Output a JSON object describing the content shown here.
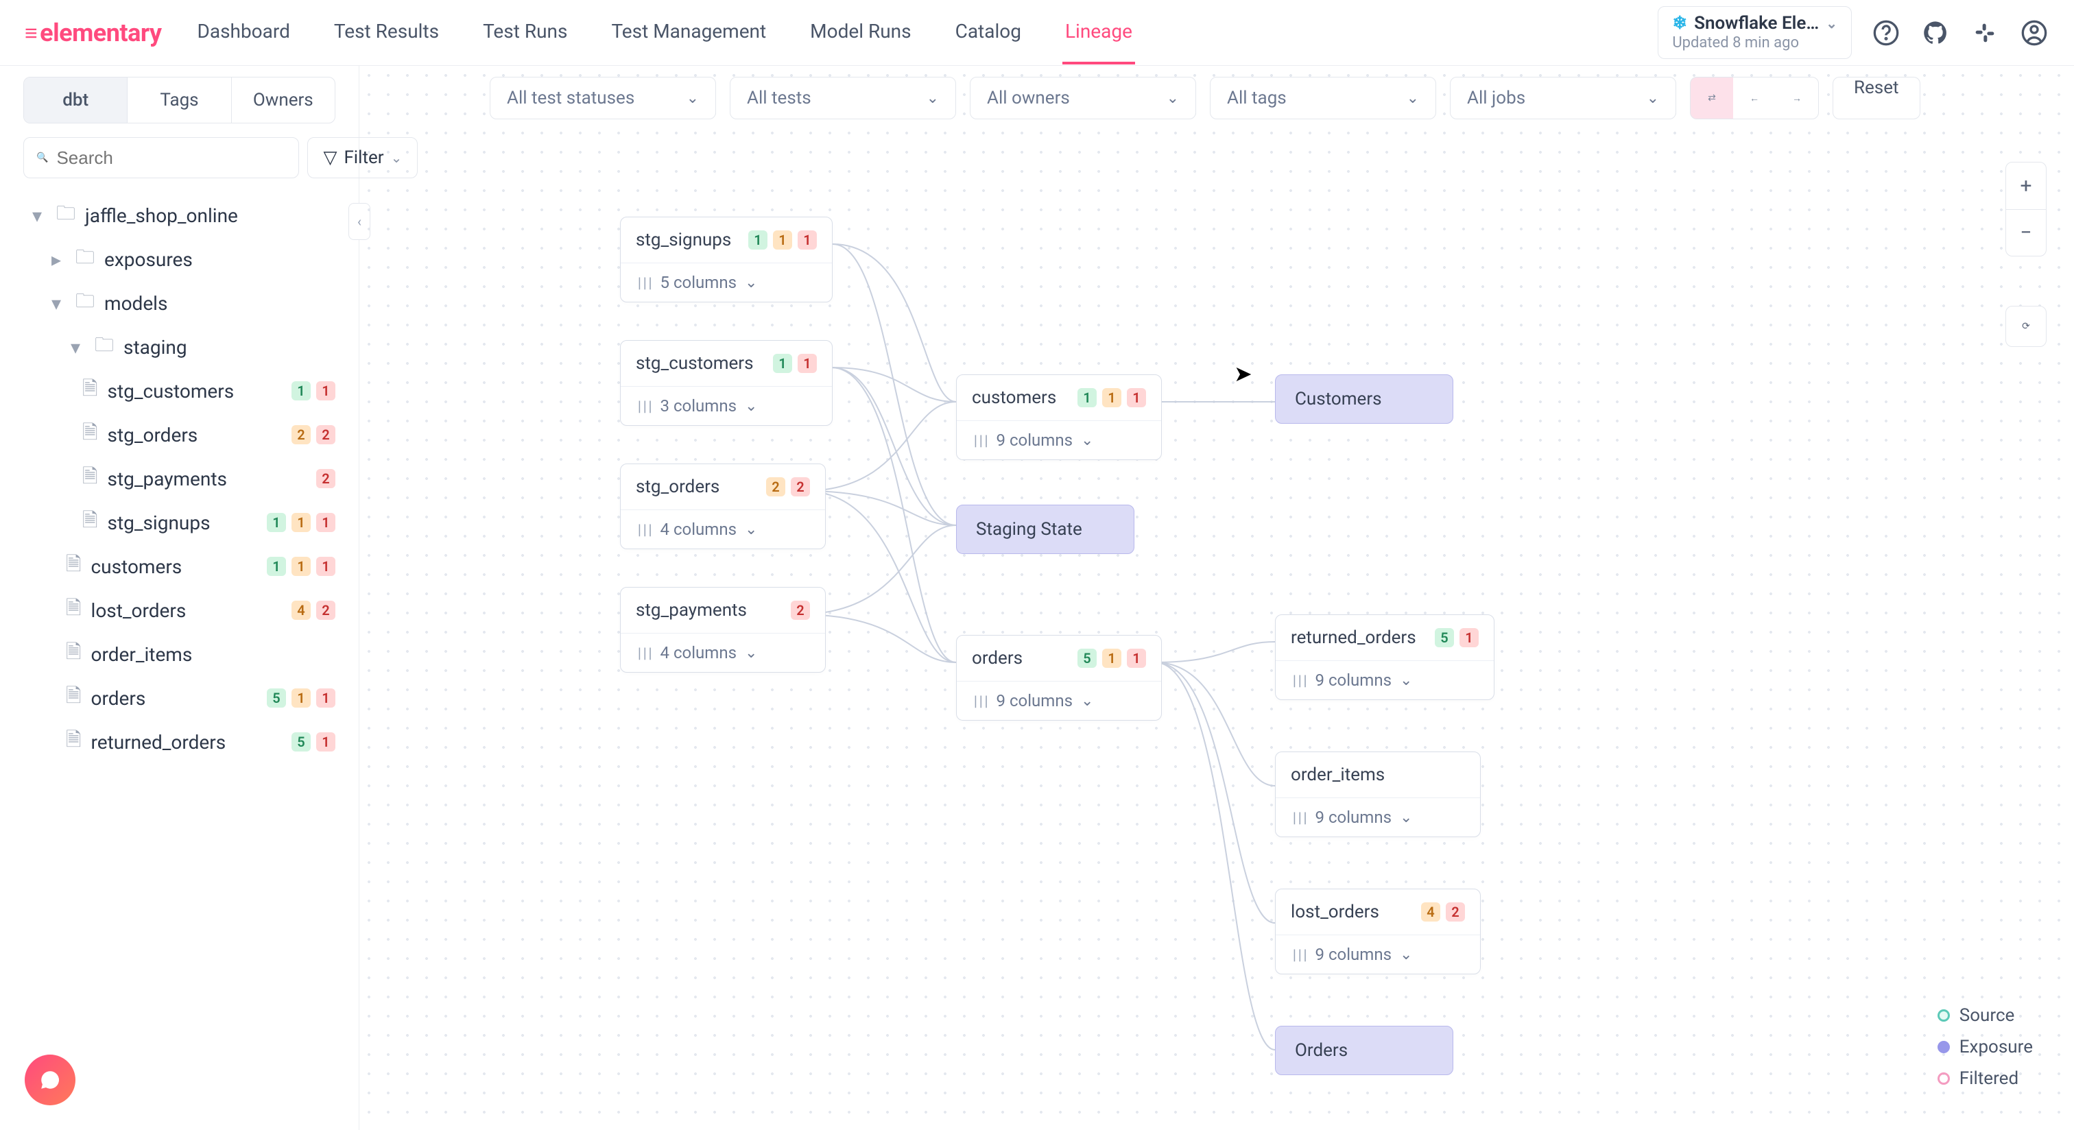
{
  "header": {
    "brand": "elementary",
    "nav": [
      "Dashboard",
      "Test Results",
      "Test Runs",
      "Test Management",
      "Model Runs",
      "Catalog",
      "Lineage"
    ],
    "active_nav": "Lineage",
    "env_name": "Snowflake Ele…",
    "env_sub": "Updated 8 min ago"
  },
  "sidebar": {
    "tabs": [
      "dbt",
      "Tags",
      "Owners"
    ],
    "active_tab": "dbt",
    "search_placeholder": "Search",
    "filter_label": "Filter",
    "tree": {
      "root": "jaffle_shop_online",
      "folders": [
        {
          "name": "exposures",
          "children": []
        },
        {
          "name": "models",
          "children": [
            {
              "name": "staging",
              "children": [
                {
                  "name": "stg_customers",
                  "badges": [
                    {
                      "c": "green",
                      "v": "1"
                    },
                    {
                      "c": "red",
                      "v": "1"
                    }
                  ]
                },
                {
                  "name": "stg_orders",
                  "badges": [
                    {
                      "c": "orange",
                      "v": "2"
                    },
                    {
                      "c": "red",
                      "v": "2"
                    }
                  ]
                },
                {
                  "name": "stg_payments",
                  "badges": [
                    {
                      "c": "red",
                      "v": "2"
                    }
                  ]
                },
                {
                  "name": "stg_signups",
                  "badges": [
                    {
                      "c": "green",
                      "v": "1"
                    },
                    {
                      "c": "orange",
                      "v": "1"
                    },
                    {
                      "c": "red",
                      "v": "1"
                    }
                  ]
                }
              ]
            },
            {
              "name": "customers",
              "badges": [
                {
                  "c": "green",
                  "v": "1"
                },
                {
                  "c": "orange",
                  "v": "1"
                },
                {
                  "c": "red",
                  "v": "1"
                }
              ]
            },
            {
              "name": "lost_orders",
              "badges": [
                {
                  "c": "orange",
                  "v": "4"
                },
                {
                  "c": "red",
                  "v": "2"
                }
              ]
            },
            {
              "name": "order_items",
              "badges": []
            },
            {
              "name": "orders",
              "badges": [
                {
                  "c": "green",
                  "v": "5"
                },
                {
                  "c": "orange",
                  "v": "1"
                },
                {
                  "c": "red",
                  "v": "1"
                }
              ]
            },
            {
              "name": "returned_orders",
              "badges": [
                {
                  "c": "green",
                  "v": "5"
                },
                {
                  "c": "red",
                  "v": "1"
                }
              ]
            }
          ]
        }
      ]
    }
  },
  "filters": {
    "status": "All test statuses",
    "tests": "All tests",
    "owners": "All owners",
    "tags": "All tags",
    "jobs": "All jobs",
    "reset": "Reset"
  },
  "legend": {
    "source": "Source",
    "exposure": "Exposure",
    "filtered": "Filtered"
  },
  "nodes": {
    "stg_signups": {
      "title": "stg_signups",
      "cols": "5 columns",
      "badges": [
        {
          "c": "green",
          "v": "1"
        },
        {
          "c": "orange",
          "v": "1"
        },
        {
          "c": "red",
          "v": "1"
        }
      ]
    },
    "stg_customers": {
      "title": "stg_customers",
      "cols": "3 columns",
      "badges": [
        {
          "c": "green",
          "v": "1"
        },
        {
          "c": "red",
          "v": "1"
        }
      ]
    },
    "stg_orders": {
      "title": "stg_orders",
      "cols": "4 columns",
      "badges": [
        {
          "c": "orange",
          "v": "2"
        },
        {
          "c": "red",
          "v": "2"
        }
      ]
    },
    "stg_payments": {
      "title": "stg_payments",
      "cols": "4 columns",
      "badges": [
        {
          "c": "red",
          "v": "2"
        }
      ]
    },
    "customers": {
      "title": "customers",
      "cols": "9 columns",
      "badges": [
        {
          "c": "green",
          "v": "1"
        },
        {
          "c": "orange",
          "v": "1"
        },
        {
          "c": "red",
          "v": "1"
        }
      ]
    },
    "orders": {
      "title": "orders",
      "cols": "9 columns",
      "badges": [
        {
          "c": "green",
          "v": "5"
        },
        {
          "c": "orange",
          "v": "1"
        },
        {
          "c": "red",
          "v": "1"
        }
      ]
    },
    "returned_orders": {
      "title": "returned_orders",
      "cols": "9 columns",
      "badges": [
        {
          "c": "green",
          "v": "5"
        },
        {
          "c": "red",
          "v": "1"
        }
      ]
    },
    "order_items": {
      "title": "order_items",
      "cols": "9 columns",
      "badges": []
    },
    "lost_orders": {
      "title": "lost_orders",
      "cols": "9 columns",
      "badges": [
        {
          "c": "orange",
          "v": "4"
        },
        {
          "c": "red",
          "v": "2"
        }
      ]
    }
  },
  "exposures": {
    "staging": "Staging State",
    "customers": "Customers",
    "orders": "Orders"
  }
}
